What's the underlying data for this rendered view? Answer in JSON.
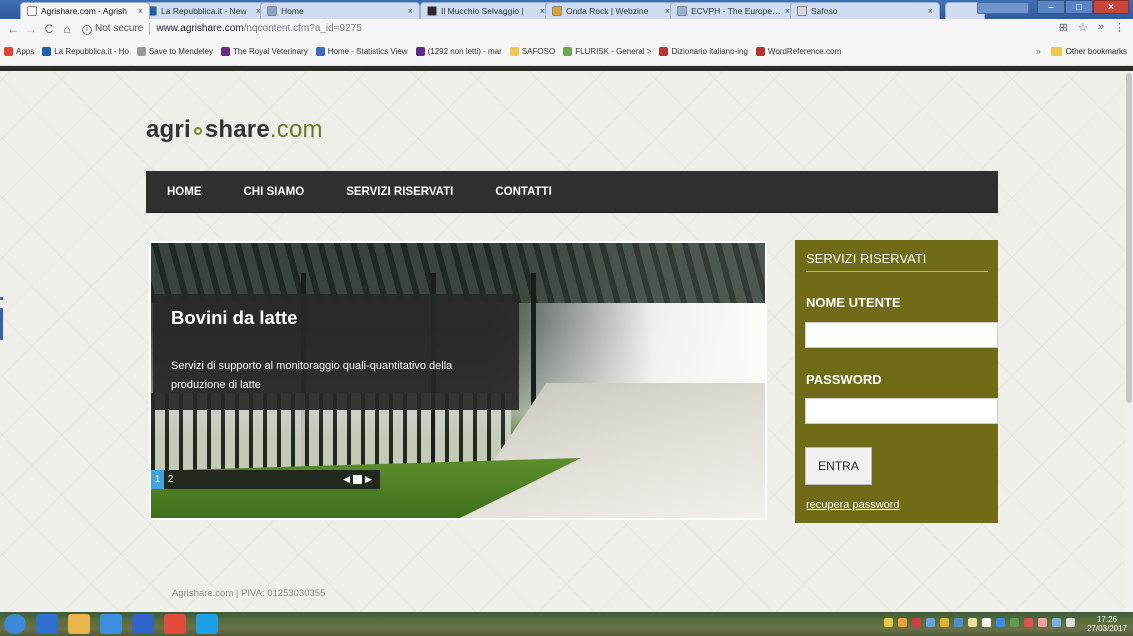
{
  "browser": {
    "tabs": [
      {
        "label": "Agrishare.com - Agrish",
        "favicon_color": "#ffffff",
        "active": true
      },
      {
        "label": "La Repubblica.it - New",
        "favicon_color": "#1a5fb4",
        "active": false
      },
      {
        "label": "Home",
        "favicon_color": "#8aa0c0",
        "active": false
      },
      {
        "label": "Il Mucchio Selvaggio |",
        "favicon_color": "#2b2b2b",
        "active": false
      },
      {
        "label": "Onda Rock | Webzine",
        "favicon_color": "#e0a030",
        "active": false
      },
      {
        "label": "ECVPH - The European",
        "favicon_color": "#8fb0d8",
        "active": false
      },
      {
        "label": "Safoso",
        "favicon_color": "#d8d8d8",
        "active": false
      }
    ],
    "security_label": "Not secure",
    "url_host": "www.agrishare.com",
    "url_path": "/nqcontent.cfm?a_id=9275",
    "bookmarks": [
      {
        "label": "Apps",
        "icon_color": "#e94235"
      },
      {
        "label": "La Repubblica.it - Ho",
        "icon_color": "#1a5fb4"
      },
      {
        "label": "Save to Mendeley",
        "icon_color": "#999999"
      },
      {
        "label": "The Royal Veterinary",
        "icon_color": "#6a2a8a"
      },
      {
        "label": "Home - Statistics View",
        "icon_color": "#3a6fc2"
      },
      {
        "label": "(1292 non letti) - mar",
        "icon_color": "#5b2c8b"
      },
      {
        "label": "SAFOSO",
        "icon_color": "#f2c94c"
      },
      {
        "label": "FLURISK - General >",
        "icon_color": "#6aa84f"
      },
      {
        "label": "Dizionario italiano-ing",
        "icon_color": "#b7352d"
      },
      {
        "label": "WordReference.com",
        "icon_color": "#b7352d"
      }
    ],
    "bookmarks_overflow": "»",
    "other_bookmarks": "Other bookmarks"
  },
  "site": {
    "logo_main": "agri",
    "logo_share": "share",
    "logo_tld": ".com",
    "nav": [
      "HOME",
      "CHI SIAMO",
      "SERVIZI RISERVATI",
      "CONTATTI"
    ],
    "slide": {
      "title": "Bovini da latte",
      "text": "Servizi di supporto al monitoraggio quali-quantitativo della produzione di latte",
      "pages": [
        "1",
        "2"
      ],
      "current_page": "1"
    },
    "login": {
      "heading": "SERVIZI RISERVATI",
      "username_label": "NOME UTENTE",
      "password_label": "PASSWORD",
      "submit_label": "ENTRA",
      "recover_label": "recupera password"
    },
    "footer": "Agrishare.com | PIVA: 01253030355"
  },
  "taskbar": {
    "time": "17:26",
    "date": "27/03/2017",
    "apps": [
      {
        "name": "start",
        "color": "#3d8ad8"
      },
      {
        "name": "media-center",
        "color": "#2f6fcf"
      },
      {
        "name": "explorer",
        "color": "#e8b64a"
      },
      {
        "name": "internet-explorer",
        "color": "#3b8fe0"
      },
      {
        "name": "outlook",
        "color": "#2f63c6"
      },
      {
        "name": "chrome",
        "color": "#e54b3c"
      },
      {
        "name": "skype",
        "color": "#1ea0e6"
      }
    ]
  }
}
